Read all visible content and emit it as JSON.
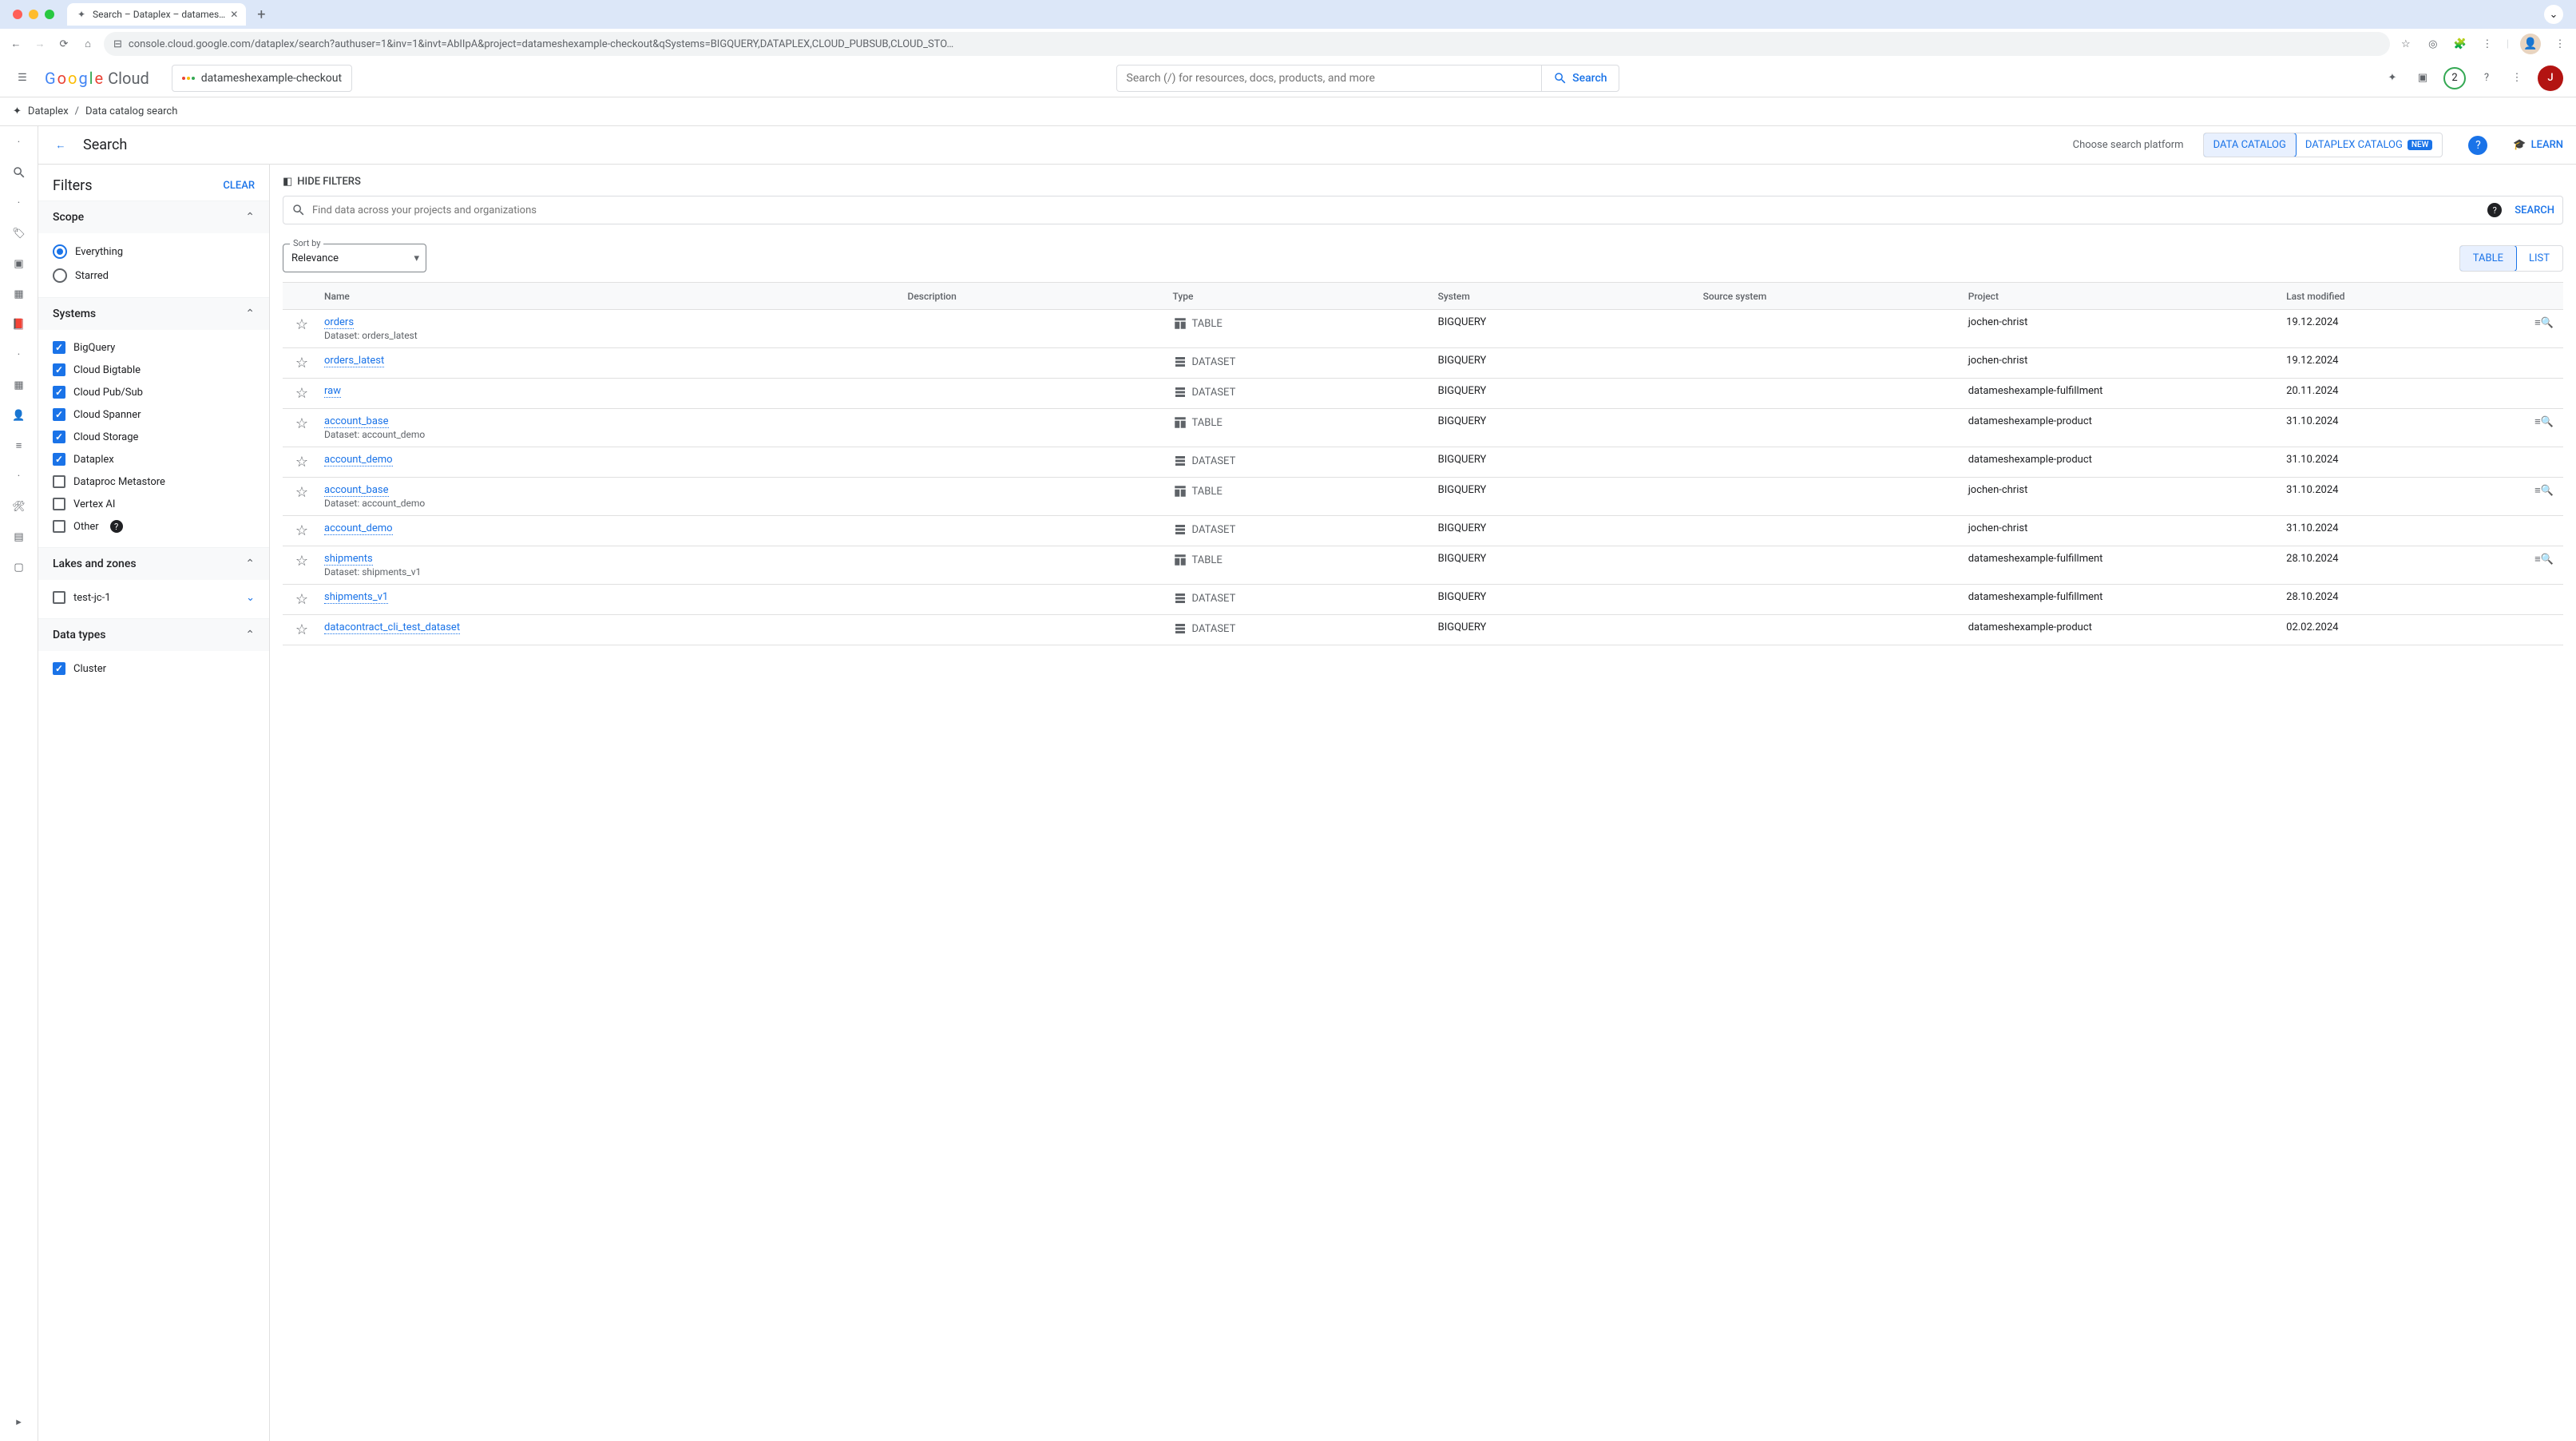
{
  "browser": {
    "tab_title": "Search – Dataplex – datames…",
    "url": "console.cloud.google.com/dataplex/search?authuser=1&inv=1&invt=AbIIpA&project=datameshexample-checkout&qSystems=BIGQUERY,DATAPLEX,CLOUD_PUBSUB,CLOUD_STO…"
  },
  "topbar": {
    "logo": "Google Cloud",
    "project": "datameshexample-checkout",
    "search_placeholder": "Search (/) for resources, docs, products, and more",
    "search_btn": "Search",
    "notification_count": "2",
    "user_initial": "J"
  },
  "breadcrumb": {
    "root": "Dataplex",
    "current": "Data catalog search"
  },
  "page": {
    "title": "Search",
    "choose_label": "Choose search platform",
    "opt_catalog": "DATA CATALOG",
    "opt_dataplex": "DATAPLEX CATALOG",
    "new_badge": "NEW",
    "learn": "LEARN"
  },
  "filters": {
    "title": "Filters",
    "clear": "CLEAR",
    "sections": {
      "scope": "Scope",
      "systems": "Systems",
      "lakes": "Lakes and zones",
      "datatypes": "Data types"
    },
    "scope_opts": {
      "everything": "Everything",
      "starred": "Starred"
    },
    "systems": [
      {
        "label": "BigQuery",
        "checked": true
      },
      {
        "label": "Cloud Bigtable",
        "checked": true
      },
      {
        "label": "Cloud Pub/Sub",
        "checked": true
      },
      {
        "label": "Cloud Spanner",
        "checked": true
      },
      {
        "label": "Cloud Storage",
        "checked": true
      },
      {
        "label": "Dataplex",
        "checked": true
      },
      {
        "label": "Dataproc Metastore",
        "checked": false
      },
      {
        "label": "Vertex AI",
        "checked": false
      },
      {
        "label": "Other",
        "checked": false,
        "help": true
      }
    ],
    "lakes": [
      {
        "label": "test-jc-1",
        "checked": false,
        "expandable": true
      }
    ],
    "datatypes": [
      {
        "label": "Cluster",
        "checked": true
      }
    ]
  },
  "results": {
    "hide_filters": "HIDE FILTERS",
    "search_placeholder": "Find data across your projects and organizations",
    "search_btn": "SEARCH",
    "sortby_label": "Sort by",
    "sortby_value": "Relevance",
    "view_table": "TABLE",
    "view_list": "LIST",
    "columns": {
      "name": "Name",
      "desc": "Description",
      "type": "Type",
      "system": "System",
      "source": "Source system",
      "project": "Project",
      "modified": "Last modified"
    },
    "rows": [
      {
        "name": "orders",
        "sub": "Dataset: orders_latest",
        "type": "TABLE",
        "system": "BIGQUERY",
        "project": "jochen-christ",
        "modified": "19.12.2024",
        "action": true
      },
      {
        "name": "orders_latest",
        "sub": "",
        "type": "DATASET",
        "system": "BIGQUERY",
        "project": "jochen-christ",
        "modified": "19.12.2024",
        "action": false
      },
      {
        "name": "raw",
        "sub": "",
        "type": "DATASET",
        "system": "BIGQUERY",
        "project": "datameshexample-fulfillment",
        "modified": "20.11.2024",
        "action": false
      },
      {
        "name": "account_base",
        "sub": "Dataset: account_demo",
        "type": "TABLE",
        "system": "BIGQUERY",
        "project": "datameshexample-product",
        "modified": "31.10.2024",
        "action": true
      },
      {
        "name": "account_demo",
        "sub": "",
        "type": "DATASET",
        "system": "BIGQUERY",
        "project": "datameshexample-product",
        "modified": "31.10.2024",
        "action": false
      },
      {
        "name": "account_base",
        "sub": "Dataset: account_demo",
        "type": "TABLE",
        "system": "BIGQUERY",
        "project": "jochen-christ",
        "modified": "31.10.2024",
        "action": true
      },
      {
        "name": "account_demo",
        "sub": "",
        "type": "DATASET",
        "system": "BIGQUERY",
        "project": "jochen-christ",
        "modified": "31.10.2024",
        "action": false
      },
      {
        "name": "shipments",
        "sub": "Dataset: shipments_v1",
        "type": "TABLE",
        "system": "BIGQUERY",
        "project": "datameshexample-fulfillment",
        "modified": "28.10.2024",
        "action": true
      },
      {
        "name": "shipments_v1",
        "sub": "",
        "type": "DATASET",
        "system": "BIGQUERY",
        "project": "datameshexample-fulfillment",
        "modified": "28.10.2024",
        "action": false
      },
      {
        "name": "datacontract_cli_test_dataset",
        "sub": "",
        "type": "DATASET",
        "system": "BIGQUERY",
        "project": "datameshexample-product",
        "modified": "02.02.2024",
        "action": false
      }
    ]
  }
}
